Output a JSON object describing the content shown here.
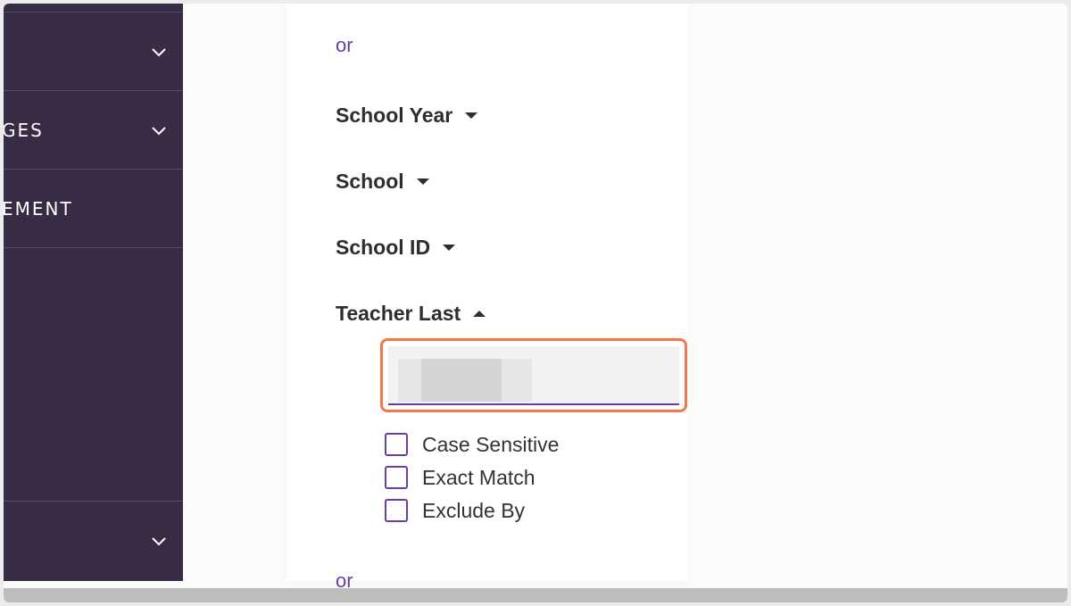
{
  "sidebar": {
    "items": [
      {
        "label": ""
      },
      {
        "label": "GES"
      },
      {
        "label": "EMENT"
      },
      {
        "label": ""
      }
    ]
  },
  "panel": {
    "or_top": "or",
    "or_bottom": "or",
    "filters": [
      {
        "label": "School Year",
        "state": "collapsed"
      },
      {
        "label": "School",
        "state": "collapsed"
      },
      {
        "label": "School ID",
        "state": "collapsed"
      },
      {
        "label": "Teacher Last",
        "state": "expanded"
      }
    ],
    "teacher_last_input": {
      "value": "",
      "placeholder": ""
    },
    "options": [
      {
        "label": "Case Sensitive",
        "checked": false
      },
      {
        "label": "Exact Match",
        "checked": false
      },
      {
        "label": "Exclude By",
        "checked": false
      }
    ]
  },
  "colors": {
    "sidebar_bg": "#372c44",
    "accent_purple": "#6a3fa0",
    "highlight_orange": "#f0794a"
  },
  "icons": {
    "sidebar_chevron": "chevron-down-icon",
    "filter_caret_down": "caret-down-icon",
    "filter_caret_up": "caret-up-icon"
  }
}
